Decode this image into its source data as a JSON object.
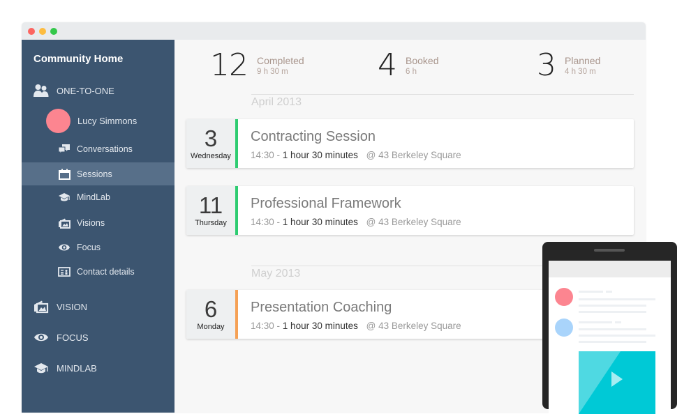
{
  "window": {
    "controls": [
      "close",
      "minimize",
      "maximize"
    ]
  },
  "sidebar": {
    "title": "Community Home",
    "section_one_to_one": {
      "label": "ONE-TO-ONE",
      "icon": "users-icon"
    },
    "user": {
      "name": "Lucy Simmons",
      "avatar_color": "#fc8590"
    },
    "sub_items": [
      {
        "label": "Conversations",
        "icon": "chat-bubbles-icon"
      },
      {
        "label": "Sessions",
        "icon": "calendar-icon",
        "active": true
      },
      {
        "label": "MindLab",
        "icon": "graduation-cap-icon"
      },
      {
        "label": "Visions",
        "icon": "picture-icon"
      },
      {
        "label": "Focus",
        "icon": "eye-icon"
      },
      {
        "label": "Contact details",
        "icon": "contact-card-icon"
      }
    ],
    "top_items": [
      {
        "label": "VISION",
        "icon": "picture-icon"
      },
      {
        "label": "FOCUS",
        "icon": "eye-icon"
      },
      {
        "label": "MINDLAB",
        "icon": "graduation-cap-icon"
      }
    ]
  },
  "stats": [
    {
      "count": "12",
      "label": "Completed",
      "duration": "9 h 30 m"
    },
    {
      "count": "4",
      "label": "Booked",
      "duration": "6 h"
    },
    {
      "count": "3",
      "label": "Planned",
      "duration": "4 h 30 m"
    }
  ],
  "months": [
    {
      "label": "April 2013",
      "sessions": [
        {
          "day": "3",
          "weekday": "Wednesday",
          "title": "Contracting Session",
          "time": "14:30 -",
          "duration": "1 hour 30 minutes",
          "location": "@ 43 Berkeley Square",
          "status_color": "#2ecc71"
        },
        {
          "day": "11",
          "weekday": "Thursday",
          "title": "Professional Framework",
          "time": "14:30 -",
          "duration": "1 hour 30 minutes",
          "location": "@ 43 Berkeley Square",
          "status_color": "#2ecc71"
        }
      ]
    },
    {
      "label": "May 2013",
      "sessions": [
        {
          "day": "6",
          "weekday": "Monday",
          "title": "Presentation Coaching",
          "time": "14:30 -",
          "duration": "1 hour 30 minutes",
          "location": "@ 43 Berkeley Square",
          "status_color": "#f5a155"
        }
      ]
    }
  ],
  "phone_mockup": {
    "avatar_colors": [
      "#fc8590",
      "#a9d4fb"
    ],
    "video_color": "#00c9d6"
  }
}
